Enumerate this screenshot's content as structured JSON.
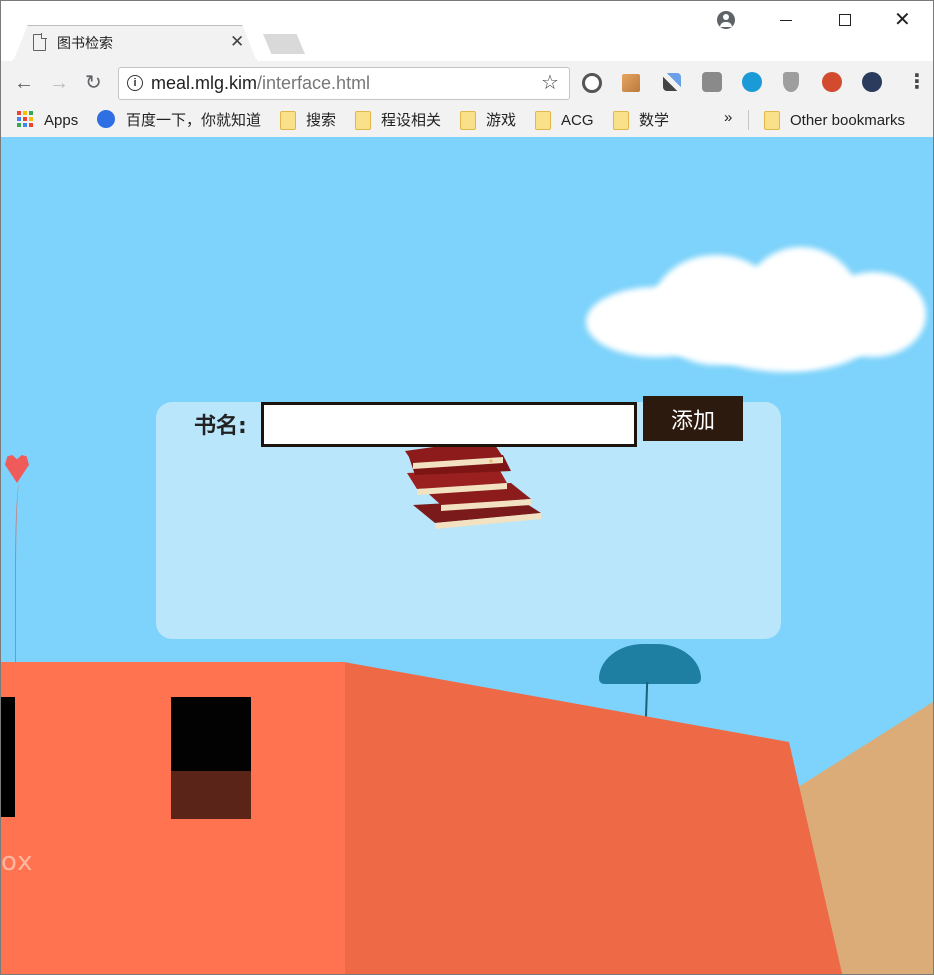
{
  "browser": {
    "tab_title": "图书检索",
    "address": {
      "host": "meal.mlg.kim",
      "path": "/interface.html"
    },
    "bookmarks": [
      {
        "label": "Apps",
        "icon": "apps-grid-icon"
      },
      {
        "label": "百度一下，你就知道",
        "icon": "baidu-paw-icon"
      },
      {
        "label": "搜索",
        "icon": "folder-icon"
      },
      {
        "label": "程设相关",
        "icon": "folder-icon"
      },
      {
        "label": "游戏",
        "icon": "folder-icon"
      },
      {
        "label": "ACG",
        "icon": "folder-icon"
      },
      {
        "label": "数学",
        "icon": "folder-icon"
      }
    ],
    "bookmarks_overflow": "»",
    "other_bookmarks": "Other bookmarks",
    "close_glyph": "✕",
    "tab_close_glyph": "✕"
  },
  "page": {
    "form": {
      "label": "书名:",
      "input_value": "",
      "submit_label": "添加"
    },
    "background_text": "ox"
  },
  "colors": {
    "sky": "#7dd3fb",
    "card": "#b9e6fb",
    "button": "#2b1a0d",
    "building_front": "#ff7350",
    "building_side": "#ee6a47",
    "hill": "#dbac78"
  }
}
